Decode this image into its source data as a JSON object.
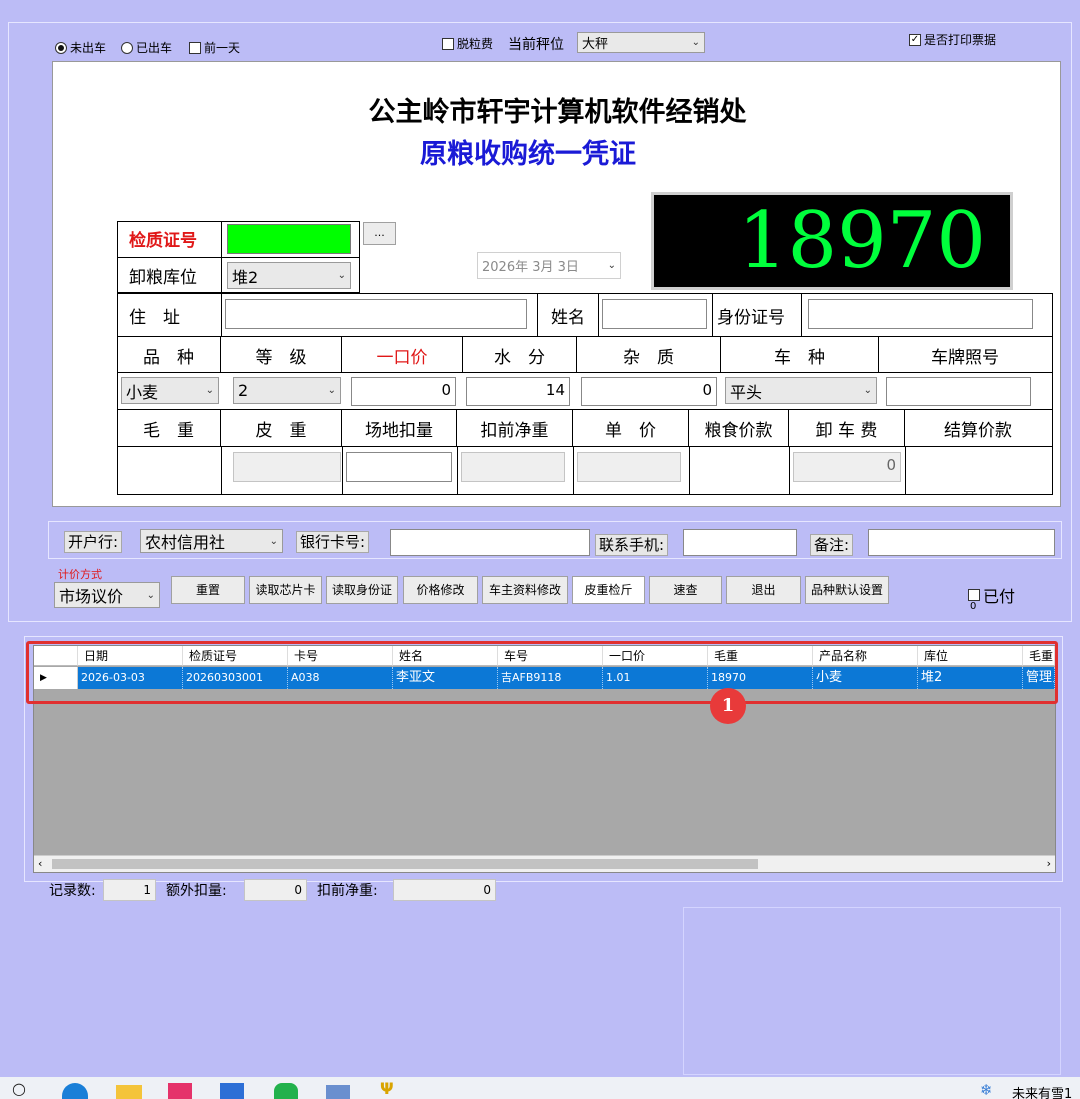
{
  "top": {
    "radio_not_out": "未出车",
    "radio_out": "已出车",
    "chk_prev_day": "前一天",
    "chk_deduct_fee": "脱粒费",
    "scale_label": "当前秤位",
    "scale_value": "大秤",
    "print_receipt": "是否打印票据"
  },
  "form": {
    "company": "公主岭市轩宇计算机软件经销处",
    "voucher_title": "原粮收购统一凭证",
    "weight_display": "18970",
    "inspection_no_label": "检质证号",
    "inspection_no_value": "",
    "more_button": "...",
    "warehouse_label": "卸粮库位",
    "warehouse_value": "堆2",
    "date_value": "2026年 3月 3日",
    "address_label": "住　址",
    "name_label": "姓名",
    "id_label": "身份证号",
    "headers": [
      "品　种",
      "等　级",
      "一口价",
      "水　分",
      "杂　质",
      "车　种",
      "车牌照号"
    ],
    "variety_value": "小麦",
    "grade_value": "2",
    "one_price_value": "0",
    "moisture_value": "14",
    "impurity_value": "0",
    "vehicle_type_value": "平头",
    "headers2": [
      "毛　重",
      "皮　重",
      "场地扣量",
      "扣前净重",
      "单　价",
      "粮食价款",
      "卸 车 费",
      "结算价款"
    ],
    "unload_fee_value": "0"
  },
  "bank": {
    "bank_label": "开户行:",
    "bank_value": "农村信用社",
    "card_label": "银行卡号:",
    "phone_label": "联系手机:",
    "note_label": "备注:"
  },
  "pricing": {
    "method_label": "计价方式",
    "method_value": "市场议价",
    "buttons": [
      "重置",
      "读取芯片卡",
      "读取身份证",
      "价格修改",
      "车主资料修改",
      "皮重检斤",
      "速查",
      "退出",
      "品种默认设置"
    ],
    "paid_label": "已付",
    "paid_value": "0"
  },
  "grid": {
    "columns": [
      "日期",
      "检质证号",
      "卡号",
      "姓名",
      "车号",
      "一口价",
      "毛重",
      "产品名称",
      "库位",
      "毛重"
    ],
    "rows": [
      [
        "2026-03-03",
        "20260303001",
        "A038",
        "李亚文",
        "吉AFB9118",
        "1.01",
        "18970",
        "小麦",
        "堆2",
        "管理员"
      ]
    ],
    "badge": "1"
  },
  "footer": {
    "records_label": "记录数:",
    "records_value": "1",
    "extra_deduct_label": "额外扣量:",
    "extra_deduct_value": "0",
    "net_label": "扣前净重:",
    "net_value": "0"
  },
  "taskbar": {
    "tray_text": "未来有雪1"
  },
  "colors": {
    "background": "#bcbcf6",
    "led_text": "#00ff3c",
    "selected_row": "#0c78d6",
    "highlight_border": "#e03030",
    "inspection_field": "#00ff00"
  }
}
